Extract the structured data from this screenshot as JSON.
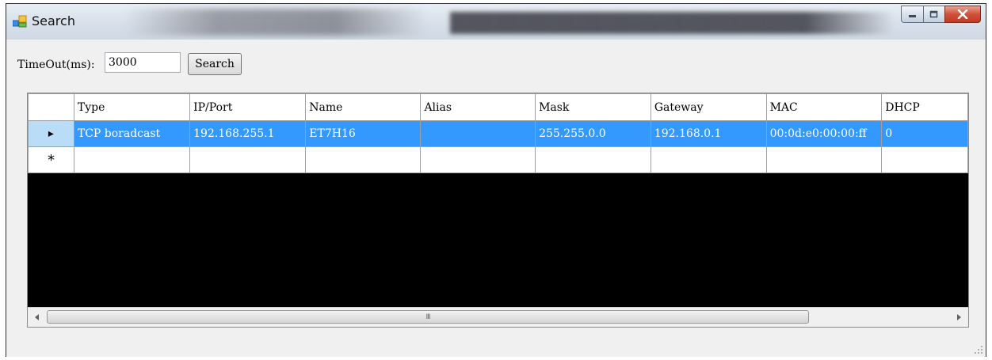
{
  "window": {
    "title": "Search"
  },
  "form": {
    "timeout_label": "TimeOut(ms):",
    "timeout_value": "3000",
    "search_label": "Search"
  },
  "grid": {
    "columns": [
      "Type",
      "IP/Port",
      "Name",
      "Alias",
      "Mask",
      "Gateway",
      "MAC",
      "DHCP"
    ],
    "rows": [
      [
        "TCP boradcast",
        "192.168.255.1",
        "ET7H16",
        "",
        "255.255.0.0",
        "192.168.0.1",
        "00:0d:e0:00:00:ff",
        "0"
      ]
    ],
    "selected_row_marker": "▸",
    "new_row_marker": "*",
    "scroll_grip": "III"
  },
  "colors": {
    "selection": "#3399ff",
    "grid_background": "#000000",
    "close_button": "#c13a24"
  }
}
